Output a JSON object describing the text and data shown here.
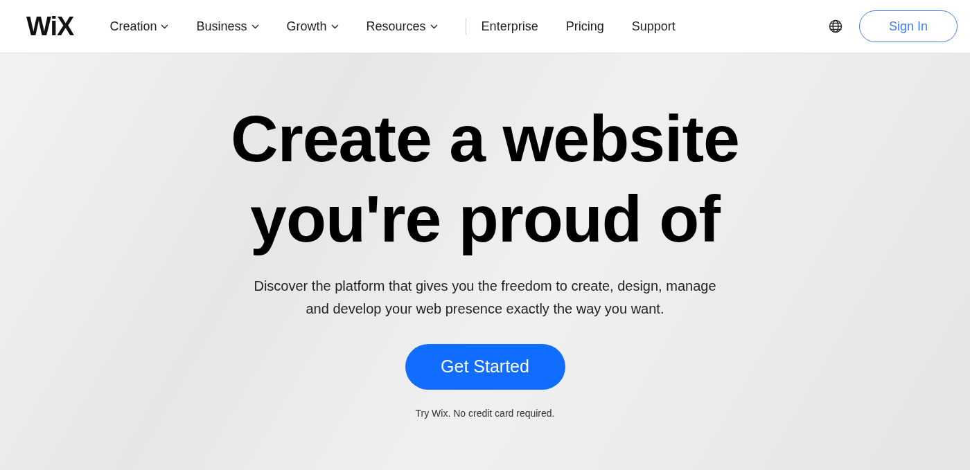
{
  "navbar": {
    "logo": "WiX",
    "items": [
      {
        "label": "Creation",
        "kind": "dropdown"
      },
      {
        "label": "Business",
        "kind": "dropdown"
      },
      {
        "label": "Growth",
        "kind": "dropdown"
      },
      {
        "label": "Resources",
        "kind": "dropdown"
      },
      {
        "label": "Enterprise",
        "kind": "link"
      },
      {
        "label": "Pricing",
        "kind": "link"
      },
      {
        "label": "Support",
        "kind": "link"
      }
    ],
    "sign_in": "Sign In"
  },
  "hero": {
    "headline": [
      "Create a website",
      "you're proud of"
    ],
    "subtitle": "Discover the platform that gives you the freedom to create, design, manage and develop your web presence exactly the way you want.",
    "cta": "Get Started",
    "note": "Try Wix. No credit card required."
  }
}
